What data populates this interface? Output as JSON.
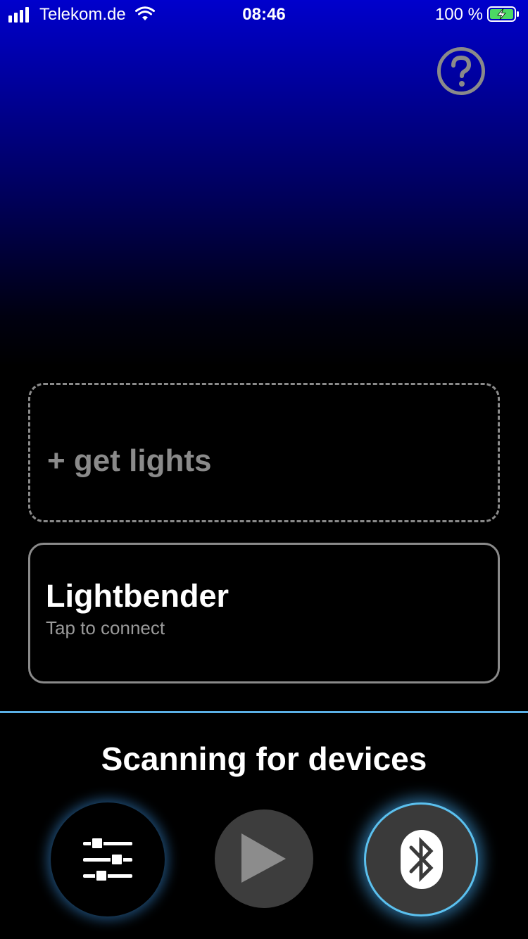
{
  "status_bar": {
    "carrier": "Telekom.de",
    "time": "08:46",
    "battery": "100 %"
  },
  "get_lights": {
    "label": "+ get lights"
  },
  "device": {
    "name": "Lightbender",
    "subtitle": "Tap to connect"
  },
  "scan_status": "Scanning for devices",
  "icons": {
    "help": "question-circle-icon",
    "settings": "sliders-icon",
    "play": "play-icon",
    "bluetooth": "bluetooth-icon"
  },
  "colors": {
    "top_gradient": "#0000cc",
    "accent": "#5bb0e6",
    "muted": "#8a8a8a",
    "battery_green": "#4cd964"
  }
}
